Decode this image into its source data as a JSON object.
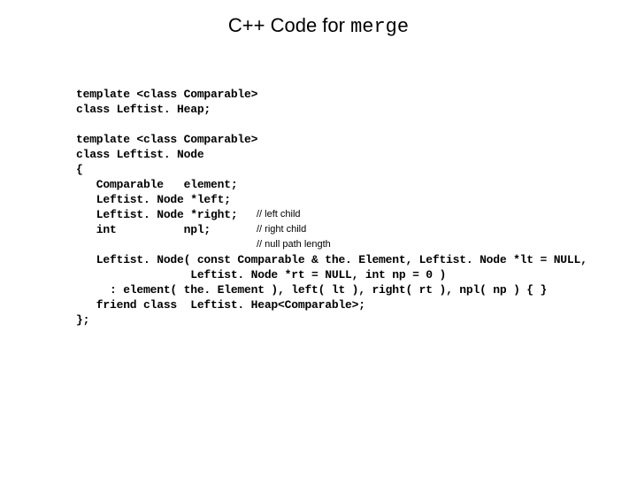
{
  "title": {
    "prefix": "C++ Code for ",
    "mono": "merge"
  },
  "code": {
    "l1a": "template <class Comparable>",
    "l2a": "class Leftist. Heap;",
    "blank1": "",
    "l1b": "template <class Comparable>",
    "l2b": "class Leftist. Node",
    "l3": "{",
    "l4": "   Comparable   element;",
    "l5": "   Leftist. Node *left;",
    "l6": "   Leftist. Node *right;",
    "l7": "   int          npl;",
    "blank2": "",
    "l8": "   Leftist. Node( const Comparable & the. Element, Leftist. Node *lt = NULL,",
    "l9": "                 Leftist. Node *rt = NULL, int np = 0 )",
    "l10": "     : element( the. Element ), left( lt ), right( rt ), npl( np ) { }",
    "l11": "   friend class  Leftist. Heap<Comparable>;",
    "l12": "};"
  },
  "annotations": {
    "a1": " // left child",
    "a2": " // right child",
    "a3": "// null path length"
  }
}
